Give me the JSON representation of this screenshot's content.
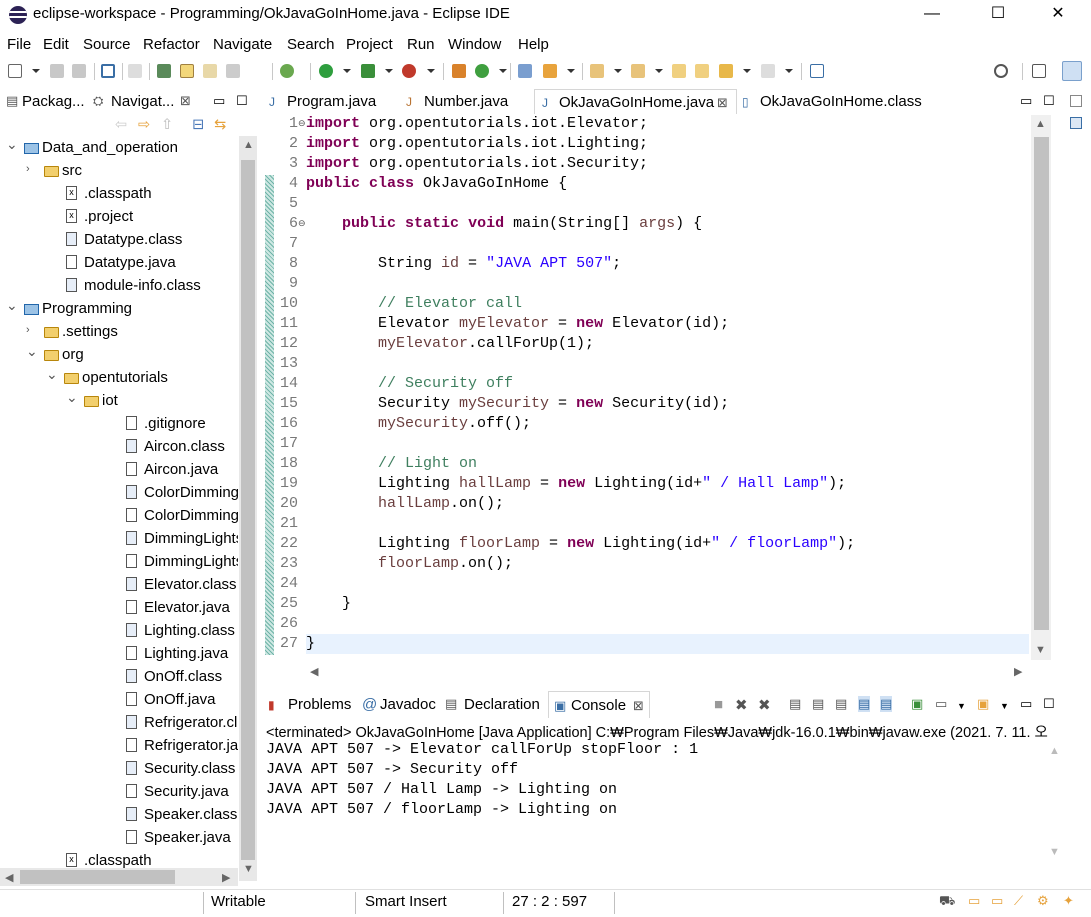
{
  "window": {
    "title": "eclipse-workspace - Programming/OkJavaGoInHome.java - Eclipse IDE",
    "minimize": "—",
    "maximize": "☐",
    "close": "✕"
  },
  "menu": [
    "File",
    "Edit",
    "Source",
    "Refactor",
    "Navigate",
    "Search",
    "Project",
    "Run",
    "Window",
    "Help"
  ],
  "left_tabs": {
    "package": "Packag...",
    "navigator": "Navigat...",
    "close": "⊠"
  },
  "tree": [
    {
      "label": "Data_and_operation",
      "depth": 0,
      "type": "project",
      "open": true
    },
    {
      "label": "src",
      "depth": 1,
      "type": "folder",
      "open": false
    },
    {
      "label": ".classpath",
      "depth": 1,
      "type": "xml"
    },
    {
      "label": ".project",
      "depth": 1,
      "type": "xml"
    },
    {
      "label": "Datatype.class",
      "depth": 1,
      "type": "class"
    },
    {
      "label": "Datatype.java",
      "depth": 1,
      "type": "java"
    },
    {
      "label": "module-info.class",
      "depth": 1,
      "type": "class"
    },
    {
      "label": "Programming",
      "depth": 0,
      "type": "project",
      "open": true
    },
    {
      "label": ".settings",
      "depth": 1,
      "type": "folder",
      "open": false
    },
    {
      "label": "org",
      "depth": 1,
      "type": "folder",
      "open": true
    },
    {
      "label": "opentutorials",
      "depth": 2,
      "type": "folder",
      "open": true
    },
    {
      "label": "iot",
      "depth": 3,
      "type": "folder",
      "open": true
    },
    {
      "label": ".gitignore",
      "depth": 4,
      "type": "text"
    },
    {
      "label": "Aircon.class",
      "depth": 4,
      "type": "class"
    },
    {
      "label": "Aircon.java",
      "depth": 4,
      "type": "java"
    },
    {
      "label": "ColorDimmingLig",
      "depth": 4,
      "type": "class"
    },
    {
      "label": "ColorDimmingLig",
      "depth": 4,
      "type": "java"
    },
    {
      "label": "DimmingLights.cl",
      "depth": 4,
      "type": "class"
    },
    {
      "label": "DimmingLights.ja",
      "depth": 4,
      "type": "java"
    },
    {
      "label": "Elevator.class",
      "depth": 4,
      "type": "class"
    },
    {
      "label": "Elevator.java",
      "depth": 4,
      "type": "java"
    },
    {
      "label": "Lighting.class",
      "depth": 4,
      "type": "class"
    },
    {
      "label": "Lighting.java",
      "depth": 4,
      "type": "java"
    },
    {
      "label": "OnOff.class",
      "depth": 4,
      "type": "class"
    },
    {
      "label": "OnOff.java",
      "depth": 4,
      "type": "java"
    },
    {
      "label": "Refrigerator.class",
      "depth": 4,
      "type": "class"
    },
    {
      "label": "Refrigerator.java",
      "depth": 4,
      "type": "java"
    },
    {
      "label": "Security.class",
      "depth": 4,
      "type": "class"
    },
    {
      "label": "Security.java",
      "depth": 4,
      "type": "java"
    },
    {
      "label": "Speaker.class",
      "depth": 4,
      "type": "class"
    },
    {
      "label": "Speaker.java",
      "depth": 4,
      "type": "java"
    },
    {
      "label": ".classpath",
      "depth": 1,
      "type": "xml"
    }
  ],
  "editor_tabs": [
    {
      "label": "Program.java",
      "active": false
    },
    {
      "label": "Number.java",
      "active": false
    },
    {
      "label": "OkJavaGoInHome.java",
      "active": true
    },
    {
      "label": "OkJavaGoInHome.class",
      "active": false
    }
  ],
  "editor_tab_close": "⊠",
  "code_lines": [
    [
      {
        "t": "import",
        "c": "kw"
      },
      {
        "t": " org.opentutorials.iot.Elevator;"
      }
    ],
    [
      {
        "t": "import",
        "c": "kw"
      },
      {
        "t": " org.opentutorials.iot.Lighting;"
      }
    ],
    [
      {
        "t": "import",
        "c": "kw"
      },
      {
        "t": " org.opentutorials.iot.Security;"
      }
    ],
    [
      {
        "t": "public",
        "c": "kw"
      },
      {
        "t": " "
      },
      {
        "t": "class",
        "c": "kw"
      },
      {
        "t": " OkJavaGoInHome {"
      }
    ],
    [],
    [
      {
        "t": "    "
      },
      {
        "t": "public",
        "c": "kw"
      },
      {
        "t": " "
      },
      {
        "t": "static",
        "c": "kw"
      },
      {
        "t": " "
      },
      {
        "t": "void",
        "c": "kw"
      },
      {
        "t": " main(String[] "
      },
      {
        "t": "args",
        "c": "fd"
      },
      {
        "t": ") {"
      }
    ],
    [],
    [
      {
        "t": "        String "
      },
      {
        "t": "id",
        "c": "fd"
      },
      {
        "t": " = "
      },
      {
        "t": "\"JAVA APT 507\"",
        "c": "str"
      },
      {
        "t": ";"
      }
    ],
    [],
    [
      {
        "t": "        "
      },
      {
        "t": "// Elevator call",
        "c": "cm"
      }
    ],
    [
      {
        "t": "        Elevator "
      },
      {
        "t": "myElevator",
        "c": "fd"
      },
      {
        "t": " = "
      },
      {
        "t": "new",
        "c": "kw"
      },
      {
        "t": " Elevator(id);"
      }
    ],
    [
      {
        "t": "        "
      },
      {
        "t": "myElevator",
        "c": "fd"
      },
      {
        "t": ".callForUp(1);"
      }
    ],
    [],
    [
      {
        "t": "        "
      },
      {
        "t": "// Security off",
        "c": "cm"
      }
    ],
    [
      {
        "t": "        Security "
      },
      {
        "t": "mySecurity",
        "c": "fd"
      },
      {
        "t": " = "
      },
      {
        "t": "new",
        "c": "kw"
      },
      {
        "t": " Security(id);"
      }
    ],
    [
      {
        "t": "        "
      },
      {
        "t": "mySecurity",
        "c": "fd"
      },
      {
        "t": ".off();"
      }
    ],
    [],
    [
      {
        "t": "        "
      },
      {
        "t": "// Light on",
        "c": "cm"
      }
    ],
    [
      {
        "t": "        Lighting "
      },
      {
        "t": "hallLamp",
        "c": "fd"
      },
      {
        "t": " = "
      },
      {
        "t": "new",
        "c": "kw"
      },
      {
        "t": " Lighting(id+"
      },
      {
        "t": "\" / Hall Lamp\"",
        "c": "str"
      },
      {
        "t": ");"
      }
    ],
    [
      {
        "t": "        "
      },
      {
        "t": "hallLamp",
        "c": "fd"
      },
      {
        "t": ".on();"
      }
    ],
    [],
    [
      {
        "t": "        Lighting "
      },
      {
        "t": "floorLamp",
        "c": "fd"
      },
      {
        "t": " = "
      },
      {
        "t": "new",
        "c": "kw"
      },
      {
        "t": " Lighting(id+"
      },
      {
        "t": "\" / floorLamp\"",
        "c": "str"
      },
      {
        "t": ");"
      }
    ],
    [
      {
        "t": "        "
      },
      {
        "t": "floorLamp",
        "c": "fd"
      },
      {
        "t": ".on();"
      }
    ],
    [],
    [
      {
        "t": "    }"
      }
    ],
    [],
    [
      {
        "t": "}"
      }
    ]
  ],
  "line_numbers": [
    "1",
    "2",
    "3",
    "4",
    "5",
    "6",
    "7",
    "8",
    "9",
    "10",
    "11",
    "12",
    "13",
    "14",
    "15",
    "16",
    "17",
    "18",
    "19",
    "20",
    "21",
    "22",
    "23",
    "24",
    "25",
    "26",
    "27"
  ],
  "bottom_tabs": [
    {
      "label": "Problems"
    },
    {
      "label": "Javadoc"
    },
    {
      "label": "Declaration"
    },
    {
      "label": "Console",
      "active": true
    }
  ],
  "console": {
    "terminated": "<terminated> OkJavaGoInHome [Java Application] C:₩Program Files₩Java₩jdk-16.0.1₩bin₩javaw.exe  (2021. 7. 11. 오",
    "output": [
      "JAVA APT 507 -> Elevator callForUp stopFloor : 1",
      "JAVA APT 507 -> Security off",
      "JAVA APT 507 / Hall Lamp -> Lighting on",
      "JAVA APT 507 / floorLamp -> Lighting on"
    ]
  },
  "status": {
    "writable": "Writable",
    "insert": "Smart Insert",
    "position": "27 : 2 : 597"
  }
}
